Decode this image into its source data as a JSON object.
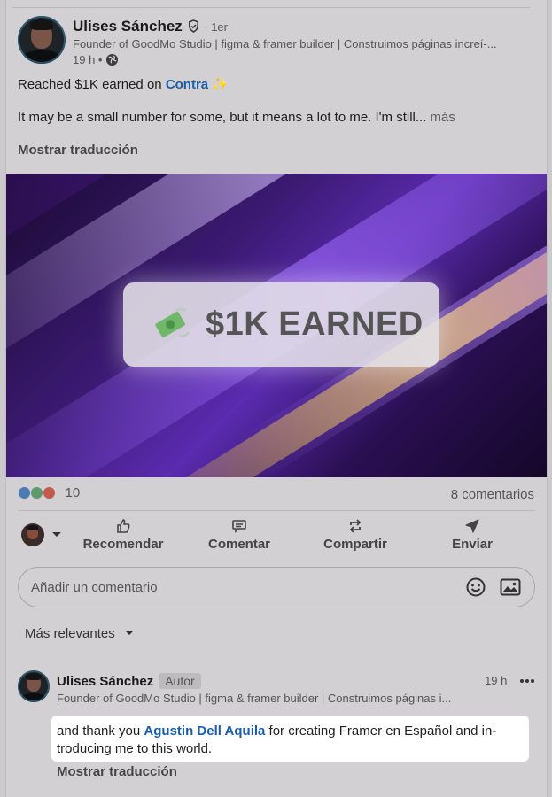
{
  "post": {
    "author_name": "Ulises Sánchez",
    "degree": "· 1er",
    "headline": "Founder of GoodMo Studio | figma & framer builder | Construimos páginas increí-...",
    "time": "19 h •",
    "text_prefix": "Reached $1K earned on",
    "text_link": "Contra",
    "text_sparkle": "✨",
    "body": "It may be a small number for some, but it means a lot to me. I'm still...",
    "more": "más",
    "translate": "Mostrar traducción",
    "banner_text": "$1K EARNED",
    "reaction_count": "10",
    "comments_count": "8 comentarios"
  },
  "actions": {
    "like": "Recomendar",
    "comment": "Comentar",
    "share": "Compartir",
    "send": "Enviar"
  },
  "comment_input": {
    "placeholder": "Añadir un comentario"
  },
  "sort": {
    "label": "Más relevantes"
  },
  "comment": {
    "author_name": "Ulises Sánchez",
    "badge": "Autor",
    "headline": "Founder of GoodMo Studio | figma & framer builder | Construimos páginas i...",
    "time": "19 h",
    "text_before": "and thank you",
    "text_link": "Agustin Dell Aquila",
    "text_after": "for creating Framer en Español and in-",
    "text_line2": "troducing me to this world.",
    "translate": "Mostrar traducción"
  },
  "colors": {
    "link": "#1a5da8",
    "banner_purple": "#5b2bb0",
    "banner_orange": "#e0842f"
  }
}
